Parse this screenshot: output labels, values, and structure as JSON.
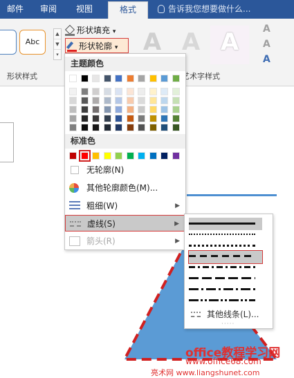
{
  "ribbon": {
    "tabs": [
      "邮件",
      "审阅",
      "视图",
      "格式"
    ],
    "active_tab": "格式",
    "tell_me": "告诉我您想要做什么...",
    "gallery_sample": "Abc",
    "shape_fill": "形状填充",
    "shape_outline": "形状轮廓",
    "shape_styles_group": "形状样式",
    "art_styles_group": "艺术字样式",
    "art_letter": "A"
  },
  "outline_menu": {
    "theme_colors_title": "主题颜色",
    "standard_colors_title": "标准色",
    "no_outline": "无轮廓(N)",
    "more_colors": "其他轮廓颜色(M)...",
    "weight": "粗细(W)",
    "dashes": "虚线(S)",
    "arrows": "箭头(R)",
    "theme_columns": [
      [
        "#ffffff",
        "#f2f2f2",
        "#d9d9d9",
        "#bfbfbf",
        "#a6a6a6",
        "#7f7f7f"
      ],
      [
        "#000000",
        "#7f7f7f",
        "#595959",
        "#3f3f3f",
        "#262626",
        "#0c0c0c"
      ],
      [
        "#e7e6e6",
        "#d0cece",
        "#aeabab",
        "#757070",
        "#3a3838",
        "#171616"
      ],
      [
        "#44546a",
        "#d6dce4",
        "#adb9ca",
        "#8496b0",
        "#333f4f",
        "#222a35"
      ],
      [
        "#4472c4",
        "#dae3f3",
        "#b4c7e7",
        "#8faadc",
        "#2f5597",
        "#203864"
      ],
      [
        "#ed7d31",
        "#fbe5d6",
        "#f8cbad",
        "#f4b183",
        "#c55a11",
        "#843c0c"
      ],
      [
        "#a5a5a5",
        "#ededed",
        "#dbdbdb",
        "#c9c9c9",
        "#7b7b7b",
        "#525252"
      ],
      [
        "#ffc000",
        "#fff2cc",
        "#ffe699",
        "#ffd966",
        "#bf9000",
        "#7f6000"
      ],
      [
        "#5b9bd5",
        "#deebf7",
        "#bdd7ee",
        "#9dc3e6",
        "#2e75b6",
        "#1f4e79"
      ],
      [
        "#70ad47",
        "#e2f0d9",
        "#c5e0b4",
        "#a9d18e",
        "#548235",
        "#385723"
      ]
    ],
    "standard_colors": [
      "#c00000",
      "#ff0000",
      "#ffc000",
      "#ffff00",
      "#92d050",
      "#00b050",
      "#00b0f0",
      "#0070c0",
      "#002060",
      "#7030a0"
    ],
    "selected_standard": "#ff0000"
  },
  "dash_menu": {
    "styles": [
      "solid",
      "round-dot",
      "square-dot",
      "dash",
      "dash-dot",
      "long-dash",
      "long-dash-dot",
      "long-dash-dot-dot"
    ],
    "selected": "dash",
    "more_lines": "其他线条(L)..."
  },
  "watermark": {
    "line1": "office教程学习网",
    "line2": "www.office68.com",
    "line3": "亮术网 www.liangshunet.com"
  }
}
